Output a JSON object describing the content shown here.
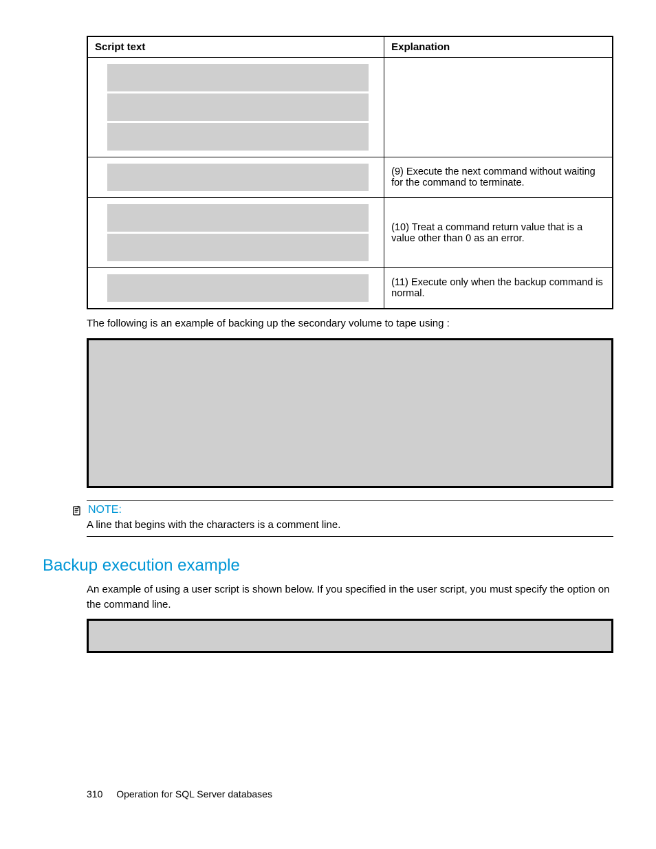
{
  "table": {
    "headers": {
      "script": "Script text",
      "explanation": "Explanation"
    },
    "rows": [
      {
        "exp": ""
      },
      {
        "exp": "(9) Execute the next command without waiting for the command to terminate."
      },
      {
        "exp": "(10) Treat a command return value that is a value other than 0 as an error."
      },
      {
        "exp": "(11) Execute only when the backup command is normal."
      }
    ]
  },
  "para1_a": "The following is an example of backing up the secondary volume to tape using ",
  "para1_b": " :",
  "note": {
    "label": "NOTE:",
    "text_a": "A line that begins with the characters ",
    "text_b": " is a comment line."
  },
  "heading": "Backup execution example",
  "para2_a": "An example of using a user script is shown below. If you specified ",
  "para2_b": " in the user script, you must specify the ",
  "para2_c": " option on the command line.",
  "footer": {
    "page": "310",
    "title": "Operation for SQL Server databases"
  }
}
